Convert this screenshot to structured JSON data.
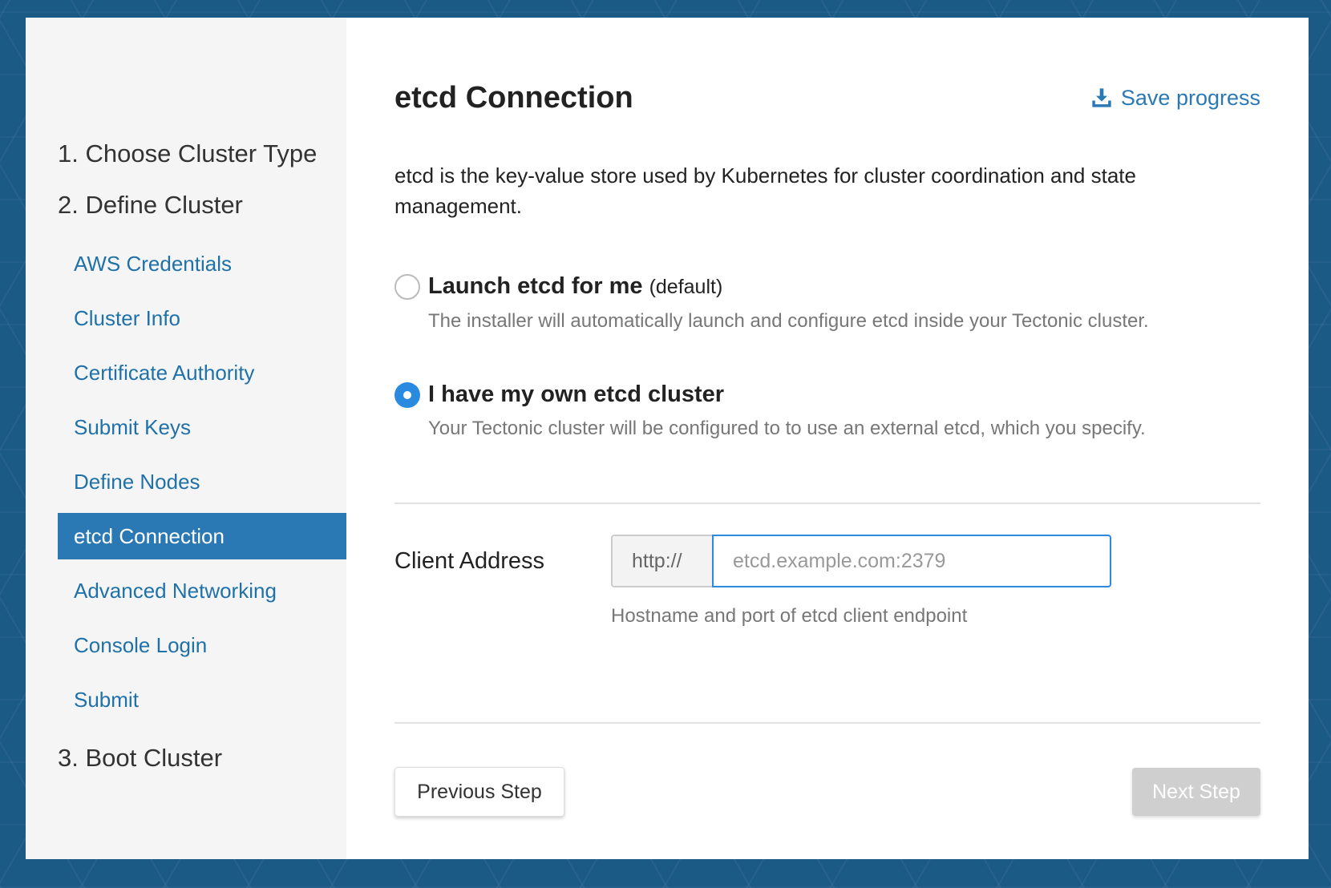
{
  "sidebar": {
    "sections": [
      {
        "label": "1. Choose Cluster Type"
      },
      {
        "label": "2. Define Cluster"
      },
      {
        "label": "3. Boot Cluster"
      }
    ],
    "items": [
      {
        "label": "AWS Credentials"
      },
      {
        "label": "Cluster Info"
      },
      {
        "label": "Certificate Authority"
      },
      {
        "label": "Submit Keys"
      },
      {
        "label": "Define Nodes"
      },
      {
        "label": "etcd Connection"
      },
      {
        "label": "Advanced Networking"
      },
      {
        "label": "Console Login"
      },
      {
        "label": "Submit"
      }
    ],
    "active_item": "etcd Connection"
  },
  "header": {
    "title": "etcd Connection",
    "save_label": "Save progress",
    "save_icon": "download-icon"
  },
  "description": "etcd is the key-value store used by Kubernetes for cluster coordination and state management.",
  "options": [
    {
      "title": "Launch etcd for me",
      "suffix": "(default)",
      "help": "The installer will automatically launch and configure etcd inside your Tectonic cluster.",
      "selected": false
    },
    {
      "title": "I have my own etcd cluster",
      "suffix": "",
      "help": "Your Tectonic cluster will be configured to to use an external etcd, which you specify.",
      "selected": true
    }
  ],
  "client_address": {
    "label": "Client Address",
    "prefix": "http://",
    "value": "",
    "placeholder": "etcd.example.com:2379",
    "help": "Hostname and port of etcd client endpoint"
  },
  "footer": {
    "previous_label": "Previous Step",
    "next_label": "Next Step"
  },
  "colors": {
    "accent": "#2a79b4",
    "radio_checked": "#2a8ae0",
    "next_disabled": "#cfcfcf"
  }
}
